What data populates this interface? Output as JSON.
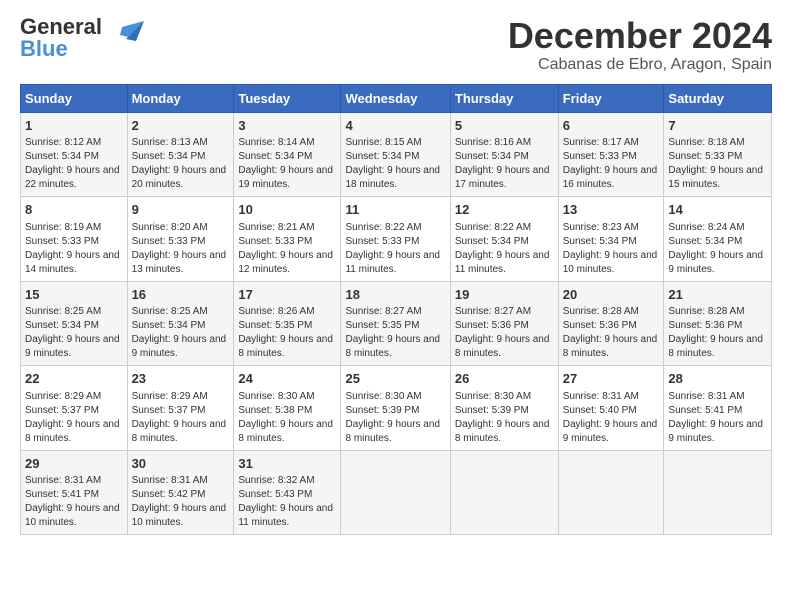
{
  "logo": {
    "line1": "General",
    "line2": "Blue"
  },
  "title": "December 2024",
  "subtitle": "Cabanas de Ebro, Aragon, Spain",
  "weekdays": [
    "Sunday",
    "Monday",
    "Tuesday",
    "Wednesday",
    "Thursday",
    "Friday",
    "Saturday"
  ],
  "weeks": [
    [
      {
        "day": "1",
        "sunrise": "8:12 AM",
        "sunset": "5:34 PM",
        "daylight": "9 hours and 22 minutes."
      },
      {
        "day": "2",
        "sunrise": "8:13 AM",
        "sunset": "5:34 PM",
        "daylight": "9 hours and 20 minutes."
      },
      {
        "day": "3",
        "sunrise": "8:14 AM",
        "sunset": "5:34 PM",
        "daylight": "9 hours and 19 minutes."
      },
      {
        "day": "4",
        "sunrise": "8:15 AM",
        "sunset": "5:34 PM",
        "daylight": "9 hours and 18 minutes."
      },
      {
        "day": "5",
        "sunrise": "8:16 AM",
        "sunset": "5:34 PM",
        "daylight": "9 hours and 17 minutes."
      },
      {
        "day": "6",
        "sunrise": "8:17 AM",
        "sunset": "5:33 PM",
        "daylight": "9 hours and 16 minutes."
      },
      {
        "day": "7",
        "sunrise": "8:18 AM",
        "sunset": "5:33 PM",
        "daylight": "9 hours and 15 minutes."
      }
    ],
    [
      {
        "day": "8",
        "sunrise": "8:19 AM",
        "sunset": "5:33 PM",
        "daylight": "9 hours and 14 minutes."
      },
      {
        "day": "9",
        "sunrise": "8:20 AM",
        "sunset": "5:33 PM",
        "daylight": "9 hours and 13 minutes."
      },
      {
        "day": "10",
        "sunrise": "8:21 AM",
        "sunset": "5:33 PM",
        "daylight": "9 hours and 12 minutes."
      },
      {
        "day": "11",
        "sunrise": "8:22 AM",
        "sunset": "5:33 PM",
        "daylight": "9 hours and 11 minutes."
      },
      {
        "day": "12",
        "sunrise": "8:22 AM",
        "sunset": "5:34 PM",
        "daylight": "9 hours and 11 minutes."
      },
      {
        "day": "13",
        "sunrise": "8:23 AM",
        "sunset": "5:34 PM",
        "daylight": "9 hours and 10 minutes."
      },
      {
        "day": "14",
        "sunrise": "8:24 AM",
        "sunset": "5:34 PM",
        "daylight": "9 hours and 9 minutes."
      }
    ],
    [
      {
        "day": "15",
        "sunrise": "8:25 AM",
        "sunset": "5:34 PM",
        "daylight": "9 hours and 9 minutes."
      },
      {
        "day": "16",
        "sunrise": "8:25 AM",
        "sunset": "5:34 PM",
        "daylight": "9 hours and 9 minutes."
      },
      {
        "day": "17",
        "sunrise": "8:26 AM",
        "sunset": "5:35 PM",
        "daylight": "9 hours and 8 minutes."
      },
      {
        "day": "18",
        "sunrise": "8:27 AM",
        "sunset": "5:35 PM",
        "daylight": "9 hours and 8 minutes."
      },
      {
        "day": "19",
        "sunrise": "8:27 AM",
        "sunset": "5:36 PM",
        "daylight": "9 hours and 8 minutes."
      },
      {
        "day": "20",
        "sunrise": "8:28 AM",
        "sunset": "5:36 PM",
        "daylight": "9 hours and 8 minutes."
      },
      {
        "day": "21",
        "sunrise": "8:28 AM",
        "sunset": "5:36 PM",
        "daylight": "9 hours and 8 minutes."
      }
    ],
    [
      {
        "day": "22",
        "sunrise": "8:29 AM",
        "sunset": "5:37 PM",
        "daylight": "9 hours and 8 minutes."
      },
      {
        "day": "23",
        "sunrise": "8:29 AM",
        "sunset": "5:37 PM",
        "daylight": "9 hours and 8 minutes."
      },
      {
        "day": "24",
        "sunrise": "8:30 AM",
        "sunset": "5:38 PM",
        "daylight": "9 hours and 8 minutes."
      },
      {
        "day": "25",
        "sunrise": "8:30 AM",
        "sunset": "5:39 PM",
        "daylight": "9 hours and 8 minutes."
      },
      {
        "day": "26",
        "sunrise": "8:30 AM",
        "sunset": "5:39 PM",
        "daylight": "9 hours and 8 minutes."
      },
      {
        "day": "27",
        "sunrise": "8:31 AM",
        "sunset": "5:40 PM",
        "daylight": "9 hours and 9 minutes."
      },
      {
        "day": "28",
        "sunrise": "8:31 AM",
        "sunset": "5:41 PM",
        "daylight": "9 hours and 9 minutes."
      }
    ],
    [
      {
        "day": "29",
        "sunrise": "8:31 AM",
        "sunset": "5:41 PM",
        "daylight": "9 hours and 10 minutes."
      },
      {
        "day": "30",
        "sunrise": "8:31 AM",
        "sunset": "5:42 PM",
        "daylight": "9 hours and 10 minutes."
      },
      {
        "day": "31",
        "sunrise": "8:32 AM",
        "sunset": "5:43 PM",
        "daylight": "9 hours and 11 minutes."
      },
      null,
      null,
      null,
      null
    ]
  ]
}
